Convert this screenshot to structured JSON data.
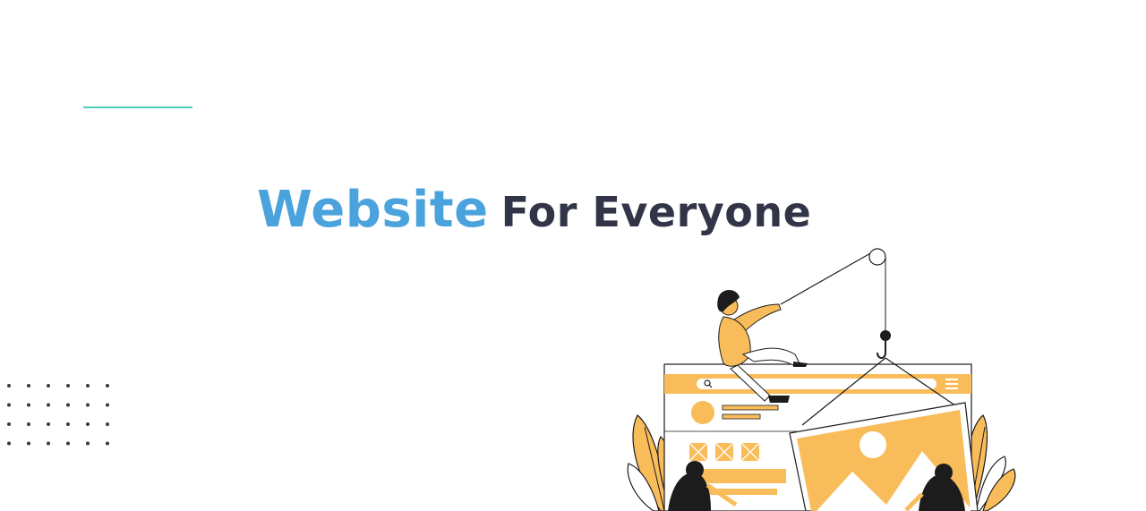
{
  "hero": {
    "title_highlight": "Website",
    "title_rest": "For Everyone"
  },
  "colors": {
    "accent_line": "#4ecdb5",
    "highlight_text": "#4aa3dc",
    "dark_text": "#323447",
    "illustration_fill": "#f9bc5a",
    "outline": "#1c1c1c"
  },
  "decor": {
    "dot_grid_rows": 4,
    "dot_grid_cols": 6
  }
}
